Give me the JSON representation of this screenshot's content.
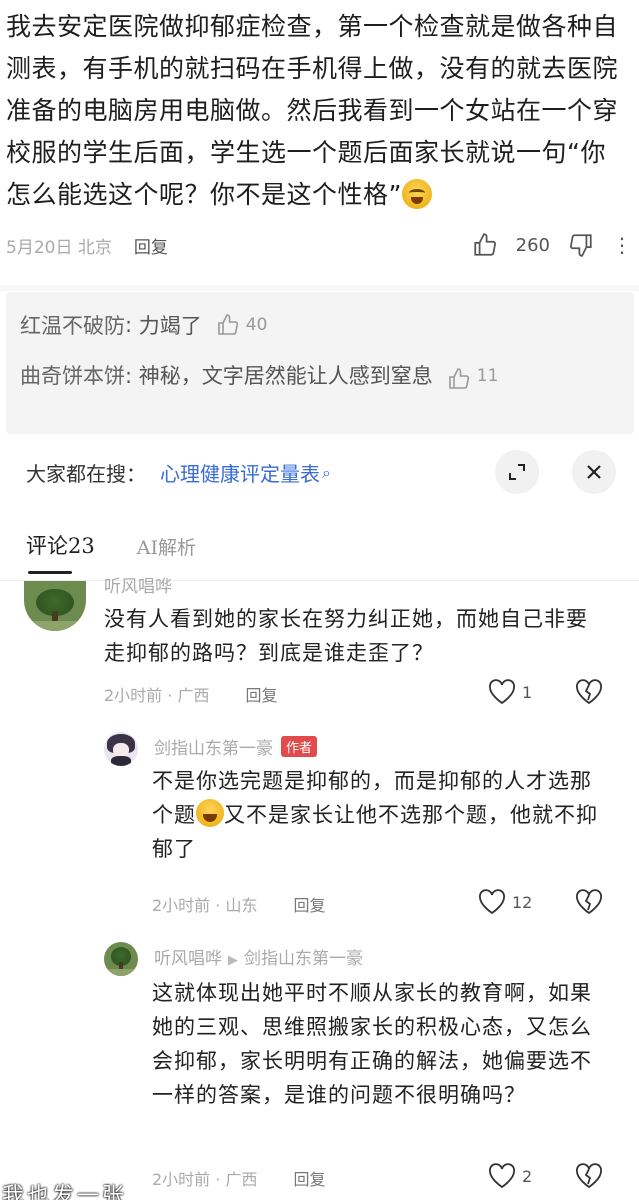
{
  "top_comment": {
    "text": "我去安定医院做抑郁症检查，第一个检查就是做各种自测表，有手机的就扫码在手机得上做，没有的就去医院准备的电脑房用电脑做。然后我看到一个女站在一个穿校服的学生后面，学生选一个题后面家长就说一句“你怎么能选这个呢？你不是这个性格”",
    "emoji": "laugh-cry-emoji",
    "date_location": "5月20日 北京",
    "reply_label": "回复",
    "like_count": "260"
  },
  "nested_replies": [
    {
      "name": "红温不破防",
      "text": "力竭了",
      "likes": "40"
    },
    {
      "name": "曲奇饼本饼",
      "text": "神秘，文字居然能让人感到窒息",
      "likes": "11"
    }
  ],
  "search_bar": {
    "prefix": "大家都在搜：",
    "keyword": "心理健康评定量表",
    "icon": "search-icon"
  },
  "tabs": [
    {
      "label": "评论23",
      "active": true
    },
    {
      "label": "AI解析",
      "active": false
    }
  ],
  "comments": [
    {
      "name": "听风唱哗",
      "text": "没有人看到她的家长在努力纠正她，而她自己非要走抑郁的路吗？到底是谁走歪了？",
      "meta": "2小时前 · 广西",
      "reply_label": "回复",
      "likes": "1"
    },
    {
      "name": "剑指山东第一豪",
      "badge": "作者",
      "text_a": "不是你选完题是抑郁的，而是抑郁的人才选那个题",
      "text_b": "又不是家长让他不选那个题，他就不抑郁了",
      "meta": "2小时前 · 山东",
      "reply_label": "回复",
      "likes": "12"
    },
    {
      "name": "听风唱哗",
      "reply_to": "剑指山东第一豪",
      "text": "这就体现出她平时不顺从家长的教育啊，如果她的三观、思维照搬家长的积极心态，又怎么会抑郁，家长明明有正确的解法，她偏要选不一样的答案，是谁的问题不很明确吗？",
      "meta": "2小时前 · 广西",
      "reply_label": "回复",
      "likes": "2"
    }
  ],
  "watermark": "我也发一张",
  "colors": {
    "accent": "#3a6bd6",
    "badge": "#e24b4b"
  }
}
